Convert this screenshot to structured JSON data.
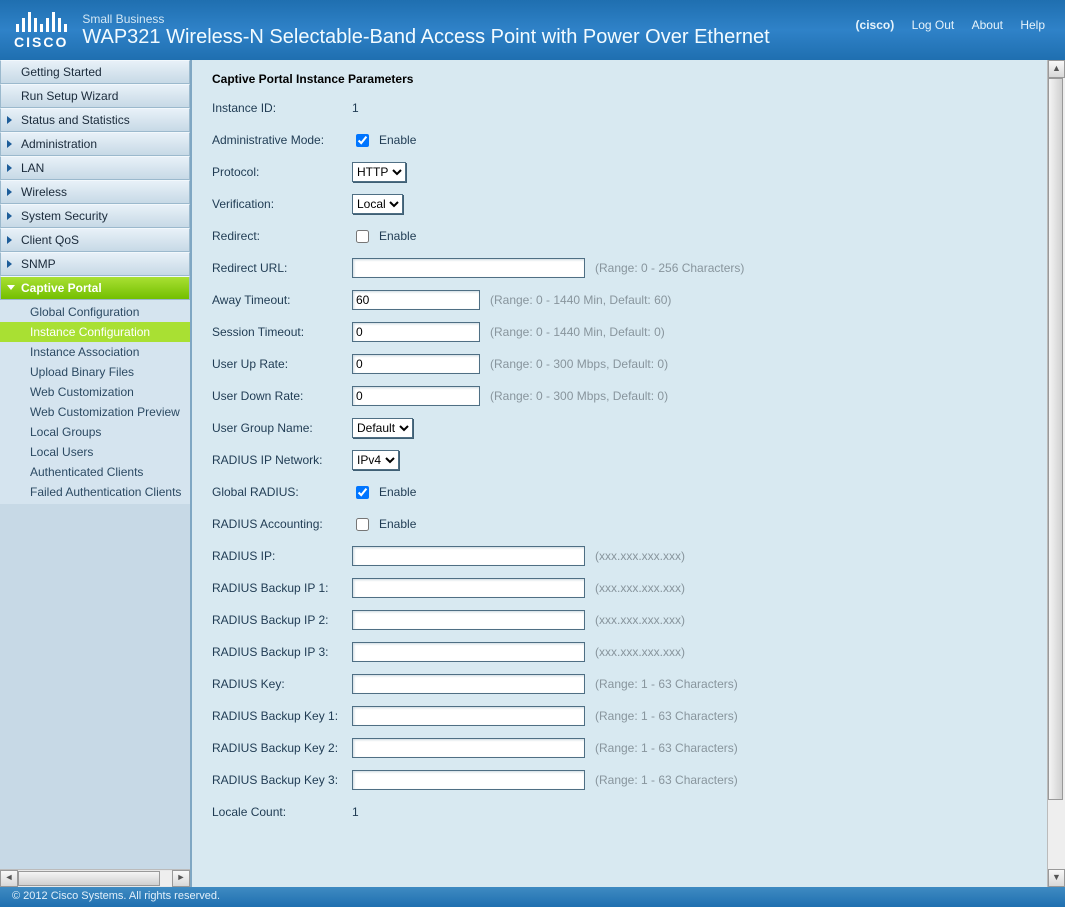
{
  "header": {
    "small_biz": "Small Business",
    "product": "WAP321 Wireless-N Selectable-Band Access Point with Power Over Ethernet",
    "user": "(cisco)",
    "logout": "Log Out",
    "about": "About",
    "help": "Help",
    "cisco": "CISCO"
  },
  "nav": {
    "items": [
      {
        "label": "Getting Started",
        "arrow": false
      },
      {
        "label": "Run Setup Wizard",
        "arrow": false
      },
      {
        "label": "Status and Statistics",
        "arrow": true
      },
      {
        "label": "Administration",
        "arrow": true
      },
      {
        "label": "LAN",
        "arrow": true
      },
      {
        "label": "Wireless",
        "arrow": true
      },
      {
        "label": "System Security",
        "arrow": true
      },
      {
        "label": "Client QoS",
        "arrow": true
      },
      {
        "label": "SNMP",
        "arrow": true
      },
      {
        "label": "Captive Portal",
        "arrow": true,
        "active": true
      }
    ],
    "sub": [
      "Global Configuration",
      "Instance Configuration",
      "Instance Association",
      "Upload Binary Files",
      "Web Customization",
      "Web Customization Preview",
      "Local Groups",
      "Local Users",
      "Authenticated Clients",
      "Failed Authentication Clients"
    ],
    "sub_selected": 1
  },
  "form": {
    "title": "Captive Portal Instance Parameters",
    "instance_id_label": "Instance ID:",
    "instance_id_value": "1",
    "admin_mode_label": "Administrative Mode:",
    "enable_text": "Enable",
    "protocol_label": "Protocol:",
    "protocol_value": "HTTP",
    "verification_label": "Verification:",
    "verification_value": "Local",
    "redirect_label": "Redirect:",
    "redirect_url_label": "Redirect URL:",
    "redirect_url_hint": "(Range: 0 - 256 Characters)",
    "away_label": "Away Timeout:",
    "away_value": "60",
    "away_hint": "(Range: 0 - 1440 Min, Default: 60)",
    "session_label": "Session Timeout:",
    "session_value": "0",
    "session_hint": "(Range: 0 - 1440 Min, Default: 0)",
    "uprate_label": "User Up Rate:",
    "uprate_value": "0",
    "uprate_hint": "(Range: 0 - 300 Mbps, Default: 0)",
    "downrate_label": "User Down Rate:",
    "downrate_value": "0",
    "downrate_hint": "(Range: 0 - 300 Mbps, Default: 0)",
    "group_label": "User Group Name:",
    "group_value": "Default",
    "radius_ipnet_label": "RADIUS IP Network:",
    "radius_ipnet_value": "IPv4",
    "global_radius_label": "Global RADIUS:",
    "radius_acct_label": "RADIUS Accounting:",
    "radius_ip_label": "RADIUS IP:",
    "ip_hint": "(xxx.xxx.xxx.xxx)",
    "radius_b1_label": "RADIUS Backup IP 1:",
    "radius_b2_label": "RADIUS Backup IP 2:",
    "radius_b3_label": "RADIUS Backup IP 3:",
    "radius_key_label": "RADIUS Key:",
    "key_hint": "(Range: 1 - 63 Characters)",
    "radius_bk1_label": "RADIUS Backup Key 1:",
    "radius_bk2_label": "RADIUS Backup Key 2:",
    "radius_bk3_label": "RADIUS Backup Key 3:",
    "locale_label": "Locale Count:",
    "locale_value": "1"
  },
  "footer": "© 2012 Cisco Systems. All rights reserved."
}
